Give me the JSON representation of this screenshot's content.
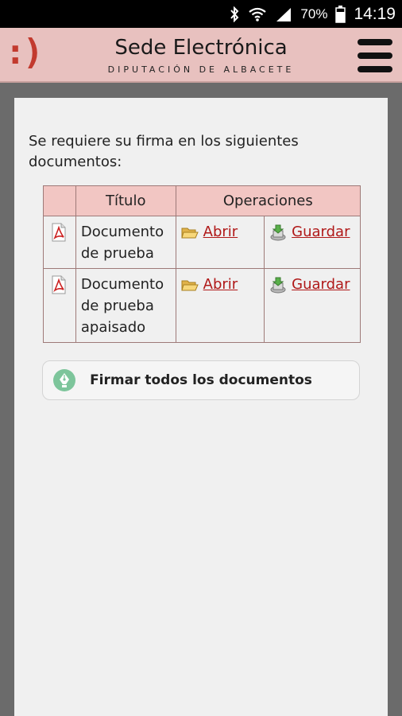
{
  "statusbar": {
    "battery": "70%",
    "time": "14:19",
    "icons": [
      "bluetooth-icon",
      "wifi-icon",
      "signal-icon",
      "battery-icon"
    ]
  },
  "header": {
    "logo": ":)",
    "title": "Sede Electrónica",
    "subtitle": "DIPUTACIÓN DE ALBACETE",
    "brand_color": "#e8c1bf",
    "logo_color": "#c23a2e"
  },
  "main": {
    "intro": " Se requiere su firma en los siguientes documentos:",
    "table": {
      "headers": {
        "title": "Título",
        "operations": "Operaciones"
      },
      "header_color": "#f2c6c3",
      "rows": [
        {
          "title": "Documento de prueba",
          "open": "Abrir",
          "save": "Guardar"
        },
        {
          "title": "Documento de prueba apaisado",
          "open": "Abrir",
          "save": "Guardar"
        }
      ]
    },
    "sign_all": "Firmar todos los documentos",
    "link_color": "#b01818"
  }
}
